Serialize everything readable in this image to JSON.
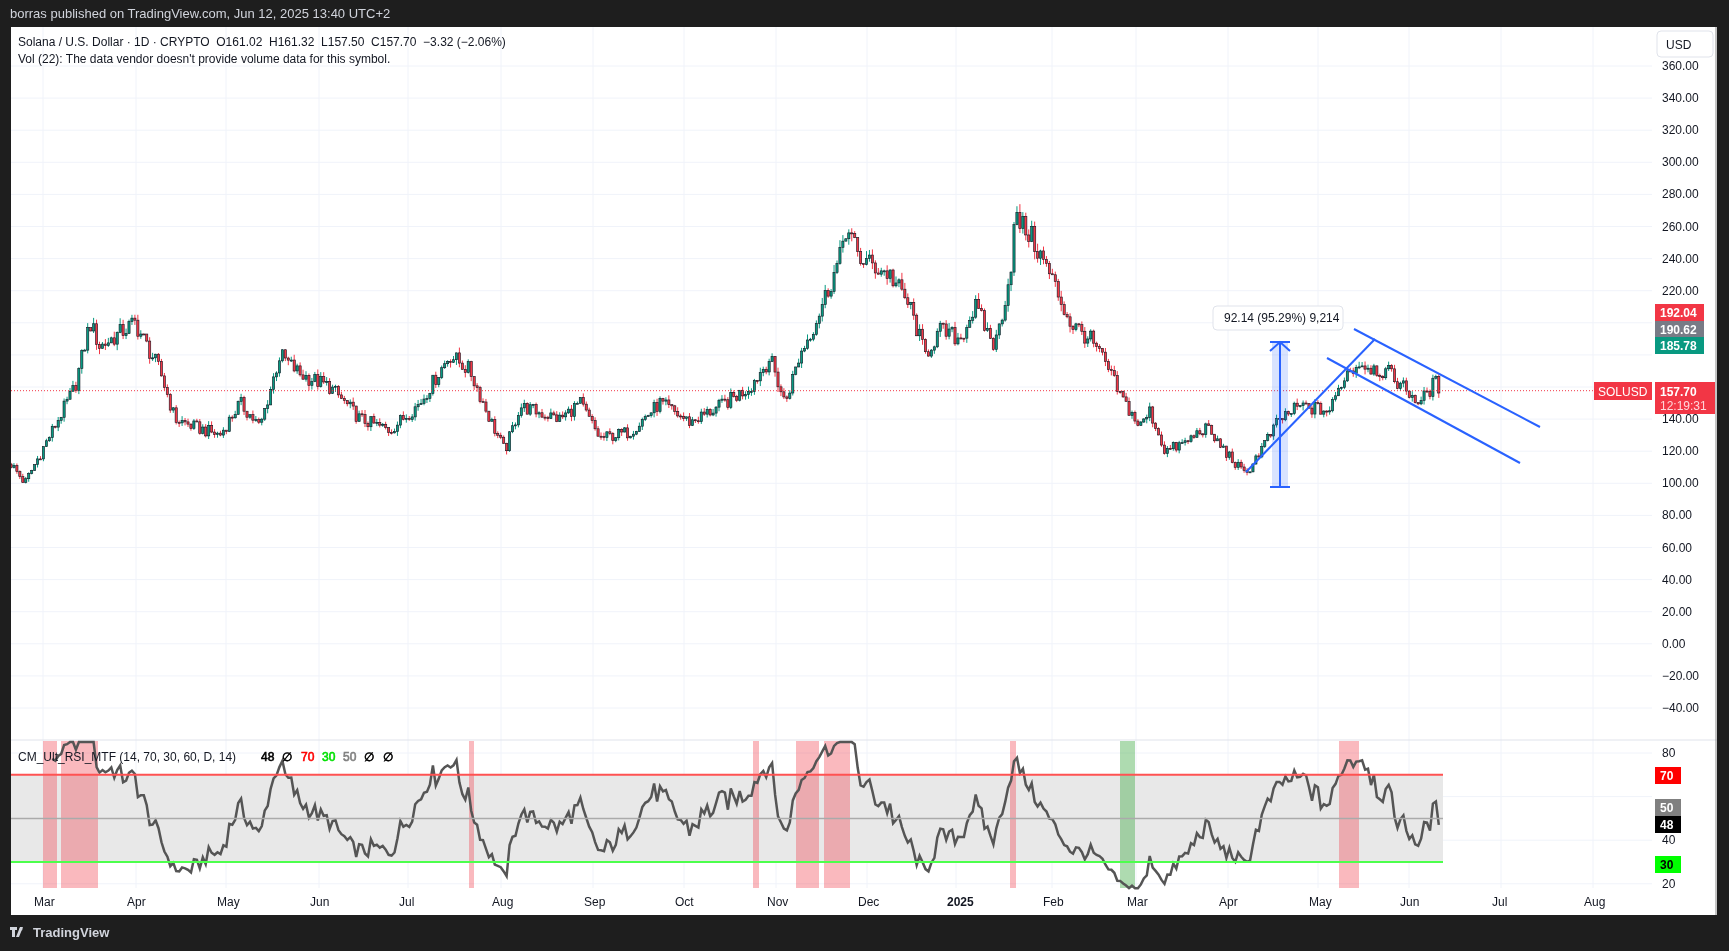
{
  "header": {
    "text": "borras published on TradingView.com, Jun 12, 2025 13:40 UTC+2"
  },
  "legend": {
    "symbol": "Solana / U.S. Dollar · 1D · CRYPTO",
    "ohlc": [
      "O161.02",
      "H161.32",
      "L157.50",
      "C157.70"
    ],
    "change": "−3.32 (−2.06%)",
    "volume_note": "Vol (22): The data vendor doesn't provide volume data for this symbol."
  },
  "currency": "USD",
  "price_axis": [
    "360.00",
    "340.00",
    "320.00",
    "300.00",
    "280.00",
    "260.00",
    "240.00",
    "220.00",
    "140.00",
    "120.00",
    "100.00",
    "80.00",
    "60.00",
    "40.00",
    "20.00",
    "0.00",
    "−20.00",
    "−40.00"
  ],
  "price_labels": [
    {
      "text": "192.04",
      "color": "#f23645"
    },
    {
      "text": "190.62",
      "color": "#787b86"
    },
    {
      "text": "185.78",
      "color": "#089981"
    }
  ],
  "last_price": {
    "symbol": "SOLUSD",
    "price": "157.70",
    "countdown": "12:19:31"
  },
  "measure_label": "92.14 (95.29%) 9,214",
  "rsi": {
    "title": "CM_Ult_RSI_MTF (14, 70, 30, 60, D, 14)",
    "values": [
      {
        "text": "48",
        "color": "#000000"
      },
      {
        "text": "∅",
        "color": "#000000"
      },
      {
        "text": "70",
        "color": "#ff0000"
      },
      {
        "text": "30",
        "color": "#00e000"
      },
      {
        "text": "50",
        "color": "#808080"
      },
      {
        "text": "∅",
        "color": "#000000"
      },
      {
        "text": "∅",
        "color": "#000000"
      }
    ],
    "axis": [
      "80",
      "40",
      "20"
    ],
    "labels": [
      {
        "text": "70",
        "color": "#ff0000"
      },
      {
        "text": "50",
        "color": "#808080"
      },
      {
        "text": "48",
        "color": "#000000"
      },
      {
        "text": "30",
        "color": "#00ff00"
      }
    ]
  },
  "time_axis": [
    {
      "text": "Mar",
      "kind": "month"
    },
    {
      "text": "Apr",
      "kind": "month"
    },
    {
      "text": "May",
      "kind": "month"
    },
    {
      "text": "Jun",
      "kind": "month"
    },
    {
      "text": "Jul",
      "kind": "month"
    },
    {
      "text": "Aug",
      "kind": "month"
    },
    {
      "text": "Sep",
      "kind": "month"
    },
    {
      "text": "Oct",
      "kind": "month"
    },
    {
      "text": "Nov",
      "kind": "month"
    },
    {
      "text": "Dec",
      "kind": "month"
    },
    {
      "text": "2025",
      "kind": "year"
    },
    {
      "text": "Feb",
      "kind": "month"
    },
    {
      "text": "Mar",
      "kind": "month"
    },
    {
      "text": "Apr",
      "kind": "month"
    },
    {
      "text": "May",
      "kind": "month"
    },
    {
      "text": "Jun",
      "kind": "month"
    },
    {
      "text": "Jul",
      "kind": "month"
    },
    {
      "text": "Aug",
      "kind": "month"
    }
  ],
  "footer": {
    "brand": "TradingView"
  }
}
